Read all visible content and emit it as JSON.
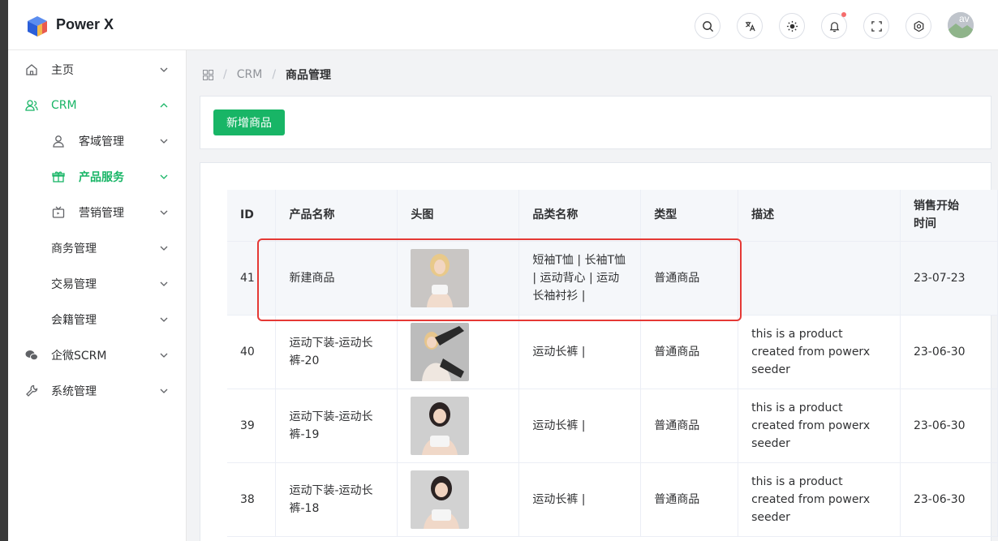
{
  "app": {
    "title": "Power X"
  },
  "header": {
    "icons": [
      "search-icon",
      "translate-icon",
      "theme-icon",
      "bell-icon",
      "fullscreen-icon",
      "settings-icon"
    ],
    "avatar_alt": "av"
  },
  "sidebar": {
    "items": [
      {
        "label": "主页",
        "icon": "home-icon"
      },
      {
        "label": "CRM",
        "icon": "users-icon",
        "active": true
      },
      {
        "label": "客域管理",
        "icon": "user-icon"
      },
      {
        "label": "产品服务",
        "icon": "gift-icon",
        "active": true
      },
      {
        "label": "营销管理",
        "icon": "tv-icon"
      },
      {
        "label": "商务管理"
      },
      {
        "label": "交易管理"
      },
      {
        "label": "会籍管理"
      },
      {
        "label": "企微SCRM",
        "icon": "wechat-icon"
      },
      {
        "label": "系统管理",
        "icon": "wrench-icon"
      }
    ]
  },
  "breadcrumb": {
    "crm": "CRM",
    "current": "商品管理"
  },
  "toolbar": {
    "add_label": "新增商品"
  },
  "table": {
    "headers": [
      "ID",
      "产品名称",
      "头图",
      "品类名称",
      "类型",
      "描述",
      "销售开始时间"
    ],
    "header_sale_line1": "销售开始",
    "header_sale_line2": "时间",
    "rows": [
      {
        "id": "41",
        "name": "新建商品",
        "category": "短袖T恤 | 长袖T恤 | 运动背心 | 运动长袖衬衫 |",
        "type": "普通商品",
        "desc": "",
        "sale_start": "23-07-23"
      },
      {
        "id": "40",
        "name": "运动下装-运动长裤-20",
        "category": "运动长裤 |",
        "type": "普通商品",
        "desc": "this is a product created from powerx seeder",
        "sale_start": "23-06-30"
      },
      {
        "id": "39",
        "name": "运动下装-运动长裤-19",
        "category": "运动长裤 |",
        "type": "普通商品",
        "desc": "this is a product created from powerx seeder",
        "sale_start": "23-06-30"
      },
      {
        "id": "38",
        "name": "运动下装-运动长裤-18",
        "category": "运动长裤 |",
        "type": "普通商品",
        "desc": "this is a product created from powerx seeder",
        "sale_start": "23-06-30"
      }
    ]
  },
  "colors": {
    "accent": "#18b566",
    "highlight": "#e53935"
  }
}
